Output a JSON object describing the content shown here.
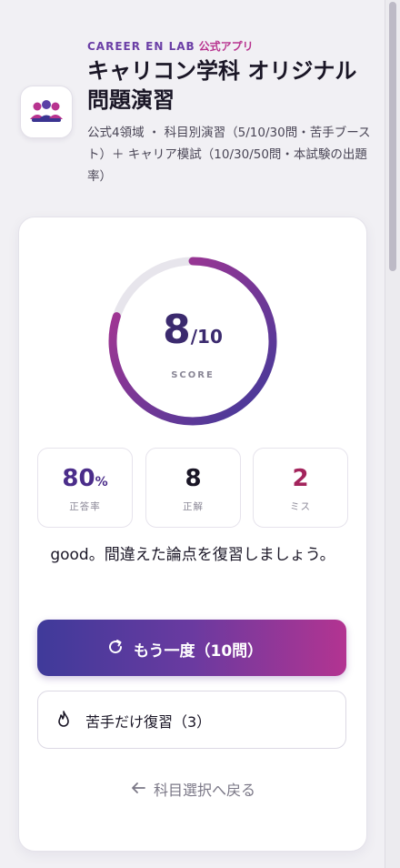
{
  "header": {
    "brand": "CAREER EN LAB",
    "brand_sub": "公式アプリ",
    "title": "キャリコン学科 オリジナル問題演習",
    "subtitle": "公式4領域 ・ 科目別演習（5/10/30問・苦手ブースト）＋ キャリア模試（10/30/50問・本試験の出題率）"
  },
  "result": {
    "score": "8",
    "score_total": "/10",
    "score_label": "SCORE",
    "score_fraction": 0.8,
    "stats": [
      {
        "value": "80",
        "unit": "%",
        "label": "正答率"
      },
      {
        "value": "8",
        "unit": "",
        "label": "正解"
      },
      {
        "value": "2",
        "unit": "",
        "label": "ミス"
      }
    ],
    "message": "good。間違えた論点を復習しましょう。",
    "retry_label": "もう一度（10問）",
    "weak_label": "苦手だけ復習（3）",
    "back_label": "科目選択へ戻る"
  },
  "icons": {
    "logo": "people-logo-icon",
    "retry": "refresh-icon",
    "weak": "flame-icon",
    "back": "arrow-left-icon"
  },
  "colors": {
    "accent_start": "#3f3a9a",
    "accent_end": "#b33491",
    "miss": "#a3245c",
    "correct_rate": "#4b2d8a"
  }
}
